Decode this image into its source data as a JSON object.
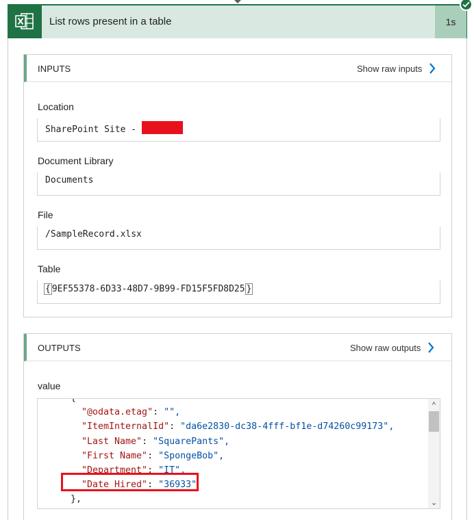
{
  "header": {
    "title": "List rows present in a table",
    "duration": "1s",
    "app_icon": "excel-icon",
    "status_icon": "checkmark-icon",
    "accent_color": "#1e7145"
  },
  "inputs": {
    "title": "INPUTS",
    "raw_link": "Show raw inputs",
    "fields": [
      {
        "label": "Location",
        "value": "SharePoint Site - "
      },
      {
        "label": "Document Library",
        "value": "Documents"
      },
      {
        "label": "File",
        "value": "/SampleRecord.xlsx"
      },
      {
        "label": "Table",
        "value": "9EF55378-6D33-48D7-9B99-FD15F5FD8D25"
      }
    ]
  },
  "outputs": {
    "title": "OUTPUTS",
    "raw_link": "Show raw outputs",
    "value_label": "value",
    "code_lines": [
      {
        "key": "\"@odata.etag\"",
        "val": "\"\","
      },
      {
        "key": "\"ItemInternalId\"",
        "val": "\"da6e2830-dc38-4fff-bf1e-d74260c99173\","
      },
      {
        "key": "\"Last Name\"",
        "val": "\"SquarePants\","
      },
      {
        "key": "\"First Name\"",
        "val": "\"SpongeBob\","
      },
      {
        "key": "\"Department\"",
        "val": "\"IT\","
      },
      {
        "key": "\"Date Hired\"",
        "val": "\"36933\""
      }
    ],
    "open_brace": "{",
    "close_brace": "},"
  }
}
